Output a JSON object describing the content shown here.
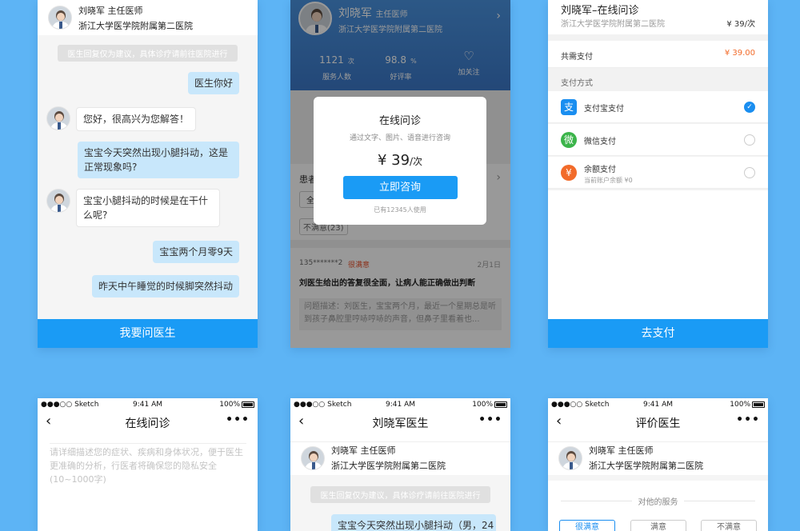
{
  "doctor": {
    "name": "刘晓军 主任医师",
    "hospital": "浙江大学医学院附属第二医院",
    "name_short": "刘晓军",
    "title_short": "主任医师"
  },
  "chat1": {
    "notice": "医生回复仅为建议，具体诊疗请前往医院进行",
    "messages": [
      "医生你好",
      "您好，很高兴为您解答！",
      "宝宝今天突然出现小腿抖动，这是正常现象吗?",
      "宝宝小腿抖动的时候是在干什么呢?",
      "宝宝两个月零9天",
      "昨天中午睡觉的时候脚突然抖动"
    ],
    "button": "我要问医生"
  },
  "profile": {
    "stats": [
      {
        "value": "1121",
        "unit": "次",
        "label": "服务人数"
      },
      {
        "value": "98.8",
        "unit": "%",
        "label": "好评率"
      },
      {
        "label": "加关注"
      }
    ],
    "modal": {
      "title": "在线问诊",
      "subtitle": "通过文字、图片、语音进行咨询",
      "price": "¥ 39",
      "price_unit": "/次",
      "button": "立即咨询",
      "usage": "已有12345人使用"
    },
    "section_label": "患者",
    "tag_left": "全",
    "tag_unsatisfied": "不满意(23)",
    "review": {
      "user": "135*******2",
      "tag": "很满意",
      "date": "2月1日",
      "title": "刘医生给出的答复很全面，让病人能正确做出判断",
      "desc": "问题描述：刘医生，宝宝两个月，最近一个星期总是听到孩子鼻腔里哼哧哼哧的声音，但鼻子里看着也..."
    }
  },
  "payment": {
    "title": "刘晓军–在线问诊",
    "hospital": "浙江大学医学院附属第二医院",
    "unit_price": "¥ 39/次",
    "total_label": "共需支付",
    "total": "¥ 39.00",
    "method_label": "支付方式",
    "methods": [
      {
        "name": "支付宝支付",
        "icon": "alipay-icon",
        "color": "#1a8ef0",
        "glyph": "支"
      },
      {
        "name": "微信支付",
        "icon": "wechat-icon",
        "color": "#3bb44a",
        "glyph": "微"
      },
      {
        "name": "余额支付",
        "sub": "当前账户余额 ¥0",
        "icon": "balance-icon",
        "color": "#f26b2a",
        "glyph": "¥"
      }
    ],
    "button": "去支付"
  },
  "status": {
    "carrier": "●●●○○ Sketch",
    "time": "9:41 AM",
    "battery": "100%"
  },
  "consult": {
    "title": "在线问诊",
    "placeholder": "请详细描述您的症状、疾病和身体状况，便于医生更准确的分析，行医者将确保您的隐私安全 (10~1000字)"
  },
  "chat2": {
    "title": "刘晓军医生",
    "notice": "医生回复仅为建议，具体诊疗请前往医院进行",
    "message": "宝宝今天突然出现小腿抖动（男，24"
  },
  "rate": {
    "title": "评价医生",
    "service_label": "对他的服务",
    "options": [
      "很满意",
      "满意",
      "不满意"
    ]
  },
  "colors": {
    "background": "#5db4f5",
    "primary": "#1a9bf5",
    "price": "#f26b2a"
  }
}
